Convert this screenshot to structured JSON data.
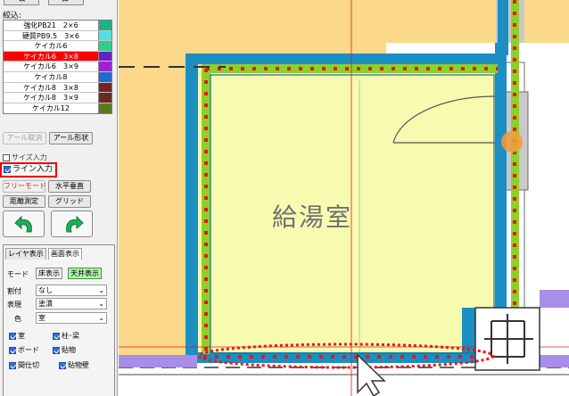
{
  "top_buttons": [
    "≪",
    "≫"
  ],
  "filter_label": "絞込:",
  "materials": [
    {
      "name": "強化PB21　2×6",
      "color": "#1db38a"
    },
    {
      "name": "硬質PB9.5　3×6",
      "color": "#4fe0e6"
    },
    {
      "name": "ケイカル6",
      "color": "#2ecf8a"
    },
    {
      "name": "ケイカル6　3×8",
      "color": "#6a1fc4",
      "selected": true
    },
    {
      "name": "ケイカル6　3×9",
      "color": "#a21fd6"
    },
    {
      "name": "ケイカル8",
      "color": "#1f6ad6"
    },
    {
      "name": "ケイカル8　3×8",
      "color": "#7a1f2a"
    },
    {
      "name": "ケイカル8　3×9",
      "color": "#6a2a1f"
    },
    {
      "name": "ケイカル12",
      "color": "#5a7a1f"
    }
  ],
  "buttons": {
    "arc_cancel": "アール取消",
    "arc_shape": "アール形状",
    "size_input": "サイズ入力",
    "line_input": "ライン入力",
    "free_mode": "フリーモード",
    "horizontal_vertical": "水平垂直",
    "distance": "距離測定",
    "grid": "グリッド"
  },
  "tabs": [
    "レイヤ表示",
    "画面表示"
  ],
  "mode_label": "モード",
  "mode_floor": "床表示",
  "mode_ceiling": "天井表示",
  "fields": [
    {
      "label": "割付",
      "value": "なし"
    },
    {
      "label": "表現",
      "value": "塗潰"
    },
    {
      "label": "色",
      "value": "室"
    }
  ],
  "checkboxes": [
    {
      "label": "室",
      "checked": true
    },
    {
      "label": "柱･梁",
      "checked": true
    },
    {
      "label": "ボード",
      "checked": true
    },
    {
      "label": "貼物",
      "checked": true
    },
    {
      "label": "間仕切",
      "checked": true
    },
    {
      "label": "貼物壁",
      "checked": true
    }
  ],
  "room_name": "給湯室",
  "colors": {
    "outer_fill": "#fcd88a",
    "room_fill": "#f6fbb0",
    "wall_blue": "#1b8fc2",
    "board_green": "#8fcf2a",
    "marker_red": "#e81818",
    "gray_panel": "#c9c9c9",
    "purple_strip": "#a78ee8",
    "orange_marker": "#f39a3a"
  }
}
